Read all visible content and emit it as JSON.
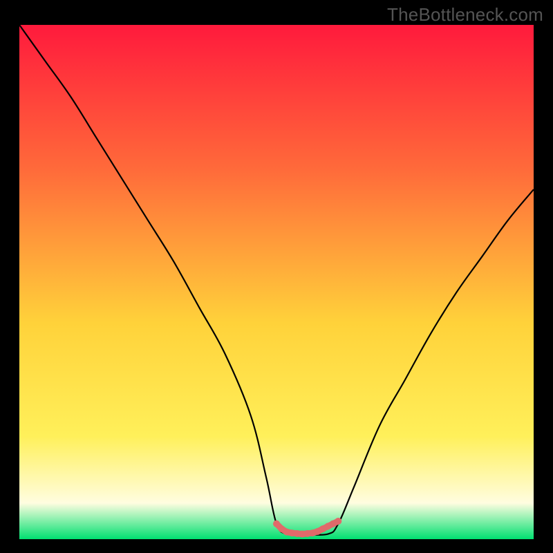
{
  "watermark": "TheBottleneck.com",
  "colors": {
    "gradient_top": "#ff1a3c",
    "gradient_mid_top": "#ff6a3a",
    "gradient_mid": "#ffd23a",
    "gradient_lower": "#fff05a",
    "gradient_cream": "#fffde0",
    "gradient_green": "#00e070",
    "frame_black": "#000000",
    "curve_stroke": "#000000",
    "bottom_curve": "#e06a6a"
  },
  "chart_data": {
    "type": "line",
    "title": "",
    "xlabel": "",
    "ylabel": "",
    "xlim": [
      0,
      100
    ],
    "ylim": [
      0,
      100
    ],
    "grid": false,
    "legend": false,
    "series": [
      {
        "name": "bottleneck-curve",
        "x": [
          0,
          5,
          10,
          15,
          20,
          25,
          30,
          35,
          40,
          45,
          48,
          50,
          52,
          55,
          60,
          62,
          65,
          70,
          75,
          80,
          85,
          90,
          95,
          100
        ],
        "y": [
          100,
          93,
          86,
          78,
          70,
          62,
          54,
          45,
          36,
          24,
          12,
          3,
          1,
          1,
          1,
          3,
          10,
          22,
          31,
          40,
          48,
          55,
          62,
          68
        ]
      },
      {
        "name": "sweet-spot-highlight",
        "x": [
          50,
          51,
          52,
          53,
          54,
          55,
          56,
          57,
          58,
          59,
          60,
          61,
          62
        ],
        "y": [
          3,
          2,
          1.4,
          1.2,
          1.1,
          1.0,
          1.1,
          1.2,
          1.5,
          2,
          2.5,
          3,
          3.5
        ]
      }
    ],
    "annotations": []
  }
}
